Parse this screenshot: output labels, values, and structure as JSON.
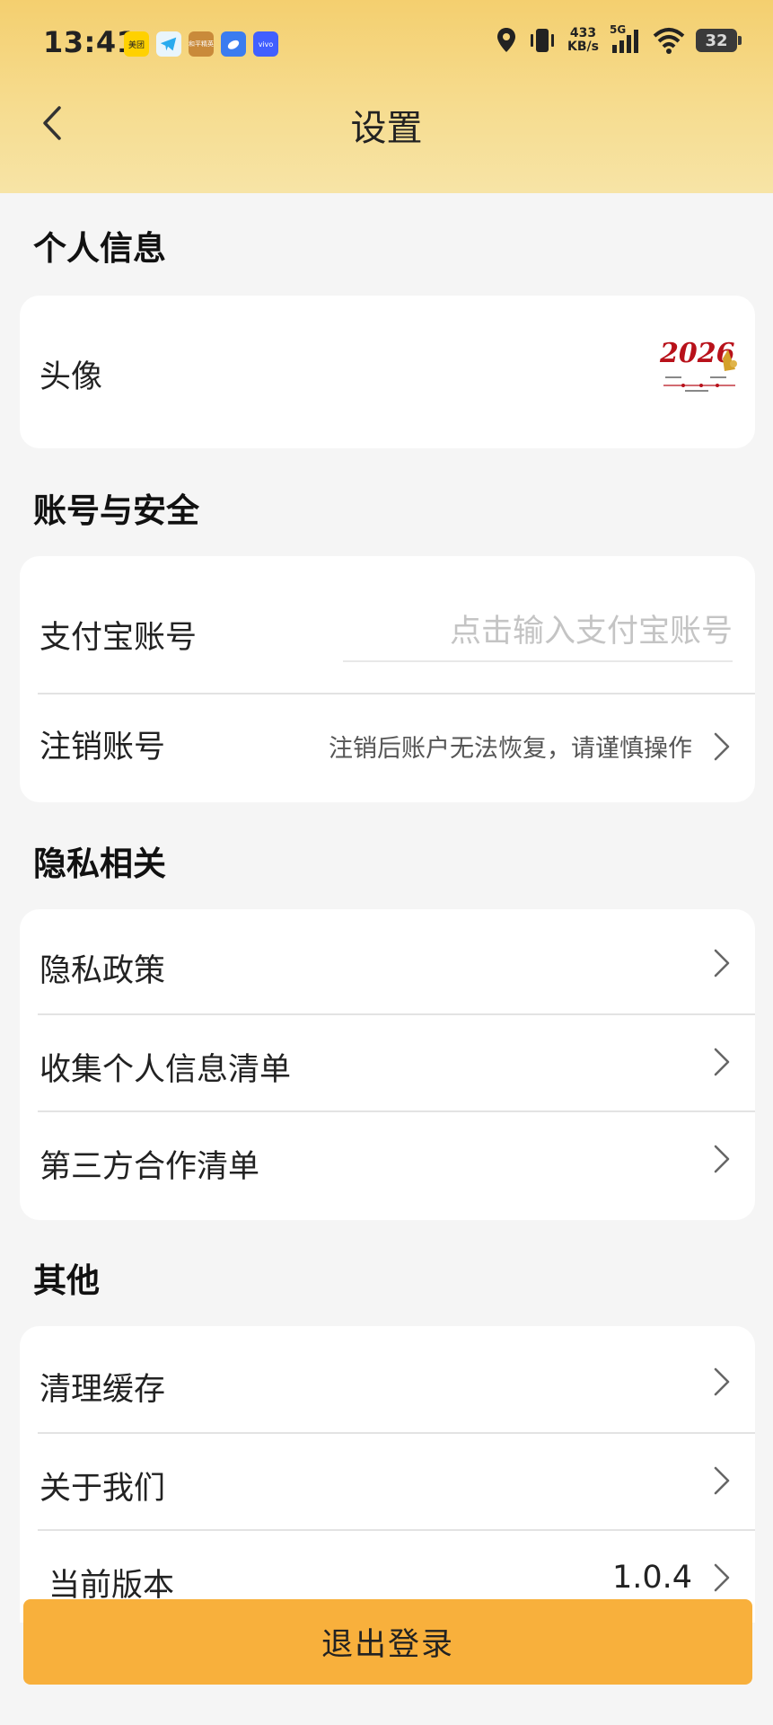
{
  "status_bar": {
    "time": "13:41",
    "net_speed_value": "433",
    "net_speed_unit": "KB/s",
    "network": "5G",
    "battery": "32",
    "app_icons": [
      {
        "name": "meituan-icon",
        "label": "美团",
        "color": "#ffd100"
      },
      {
        "name": "telegram-icon",
        "label": "",
        "color": "#2aabee"
      },
      {
        "name": "game-app-icon",
        "label": "和平精英",
        "color": "#c98a3a"
      },
      {
        "name": "cloud-app-icon",
        "label": "",
        "color": "#3b7cf0"
      },
      {
        "name": "vivo-icon",
        "label": "vivo",
        "color": "#415fff"
      }
    ]
  },
  "header": {
    "title": "设置"
  },
  "sections": {
    "personal": {
      "title": "个人信息",
      "avatar_label": "头像",
      "avatar_text": "2026"
    },
    "account": {
      "title": "账号与安全",
      "alipay_label": "支付宝账号",
      "alipay_placeholder": "点击输入支付宝账号",
      "alipay_value": "",
      "delete_label": "注销账号",
      "delete_hint": "注销后账户无法恢复，请谨慎操作"
    },
    "privacy": {
      "title": "隐私相关",
      "items": [
        "隐私政策",
        "收集个人信息清单",
        "第三方合作清单"
      ]
    },
    "other": {
      "title": "其他",
      "clear_cache": "清理缓存",
      "about_us": "关于我们",
      "version_label": "当前版本",
      "version_value": "1.0.4"
    }
  },
  "logout": {
    "label": "退出登录"
  },
  "colors": {
    "header_gradient_top": "#f4cf6f",
    "header_gradient_bottom": "#f7e4a6",
    "logout_button": "#f8b03c",
    "background": "#f5f5f5"
  }
}
